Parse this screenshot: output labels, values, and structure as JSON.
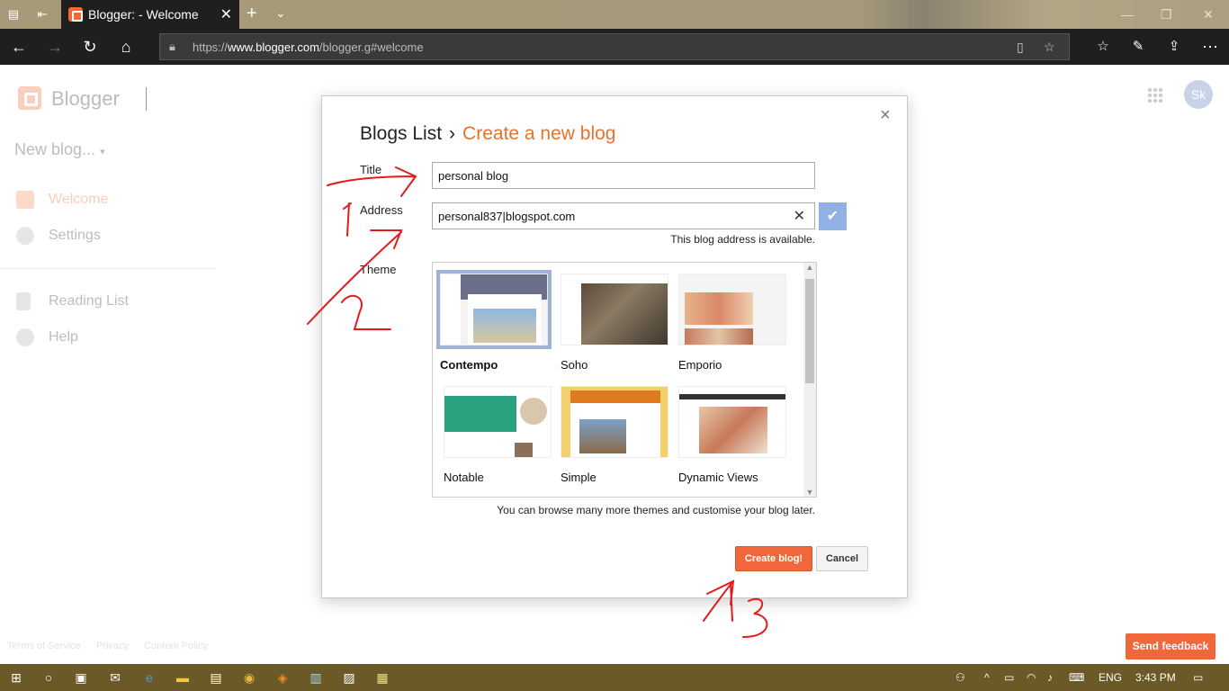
{
  "browser": {
    "tab_title": "Blogger: - Welcome",
    "url_prefix": "https://",
    "url_host": "www.blogger.com",
    "url_path": "/blogger.g#welcome"
  },
  "app": {
    "brand": "Blogger",
    "avatar_initials": "Sk",
    "new_blog": "New blog...",
    "nav": [
      "Welcome",
      "Settings",
      "Reading List",
      "Help"
    ],
    "footer_links": [
      "Terms of Service",
      "Privacy",
      "Content Policy"
    ],
    "send_feedback": "Send feedback"
  },
  "dialog": {
    "crumb_root": "Blogs List",
    "crumb_sep": "›",
    "crumb_current": "Create a new blog",
    "close_glyph": "×",
    "title_label": "Title",
    "title_value": "personal blog",
    "address_label": "Address",
    "address_value": "personal837|blogspot.com",
    "address_status": "This blog address is available.",
    "theme_label": "Theme",
    "themes": [
      "Contempo",
      "Soho",
      "Emporio",
      "Notable",
      "Simple",
      "Dynamic Views"
    ],
    "selected_theme": "Contempo",
    "browse_note": "You can browse many more themes and customise your blog later.",
    "create_label": "Create blog!",
    "cancel_label": "Cancel"
  },
  "taskbar": {
    "language": "ENG",
    "time": "3:43 PM"
  },
  "colors": {
    "accent": "#f0673b",
    "crumb_current": "#e8722c",
    "browser_bg": "#1f1f1f",
    "taskbar": "#6b5928",
    "annotation": "#e31b1b"
  }
}
